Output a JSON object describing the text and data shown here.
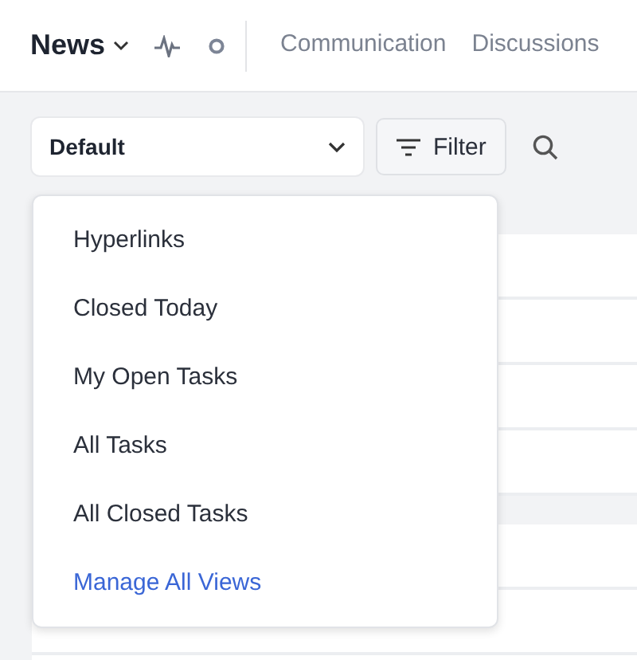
{
  "header": {
    "title": "News",
    "tabs": [
      {
        "label": "Communication",
        "selected": false
      },
      {
        "label": "Discussions",
        "selected": false
      }
    ]
  },
  "toolbar": {
    "view_select": {
      "value": "Default",
      "expanded": true
    },
    "filter_button": {
      "label": "Filter"
    }
  },
  "views_menu": {
    "items": [
      {
        "label": "Hyperlinks",
        "kind": "view"
      },
      {
        "label": "Closed Today",
        "kind": "view"
      },
      {
        "label": "My Open Tasks",
        "kind": "view"
      },
      {
        "label": "All Tasks",
        "kind": "view"
      },
      {
        "label": "All Closed Tasks",
        "kind": "view"
      },
      {
        "label": "Manage All Views",
        "kind": "link"
      }
    ]
  }
}
